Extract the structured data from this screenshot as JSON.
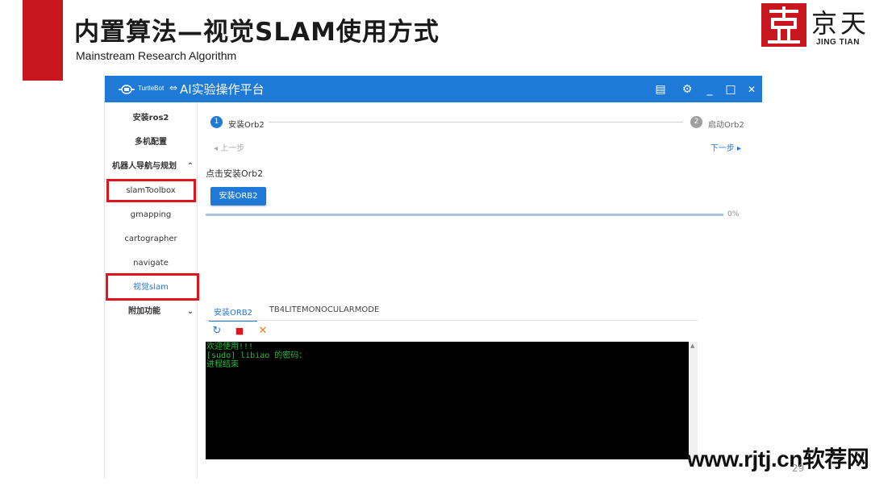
{
  "slide": {
    "title": "内置算法—视觉SLAM使用方式",
    "subtitle": "Mainstream Research Algorithm",
    "page_number": "29",
    "accent_color": "#c8171f"
  },
  "logo": {
    "cn_text": "京天",
    "en_text": "JING TIAN"
  },
  "app": {
    "logo_text": "TurtleBot",
    "logo_symbol": "⇔",
    "title": "AI实验操作平台",
    "controls": {
      "list_icon": "▤",
      "settings_icon": "⚙",
      "minimize": "_",
      "maximize": "□",
      "close": "✕"
    },
    "sidebar": {
      "items": [
        {
          "label": "安装ros2"
        },
        {
          "label": "多机配置"
        },
        {
          "label": "机器人导航与规划",
          "chevron": "⌃"
        },
        {
          "label": "slamToolbox"
        },
        {
          "label": "gmapping"
        },
        {
          "label": "cartographer"
        },
        {
          "label": "navigate"
        },
        {
          "label": "视觉slam"
        },
        {
          "label": "附加功能",
          "chevron": "⌄"
        }
      ]
    },
    "stepper": {
      "steps": [
        {
          "number": "1",
          "label": "安装Orb2",
          "active": true
        },
        {
          "number": "2",
          "label": "启动Orb2",
          "active": false
        }
      ],
      "prev_label": "上一步",
      "next_label": "下一步"
    },
    "hint": "点击安装Orb2",
    "install_button": "安装ORB2",
    "progress": {
      "value": 0,
      "label": "0%"
    },
    "tabs": [
      {
        "label": "安装ORB2",
        "active": true
      },
      {
        "label": "TB4LITEMONOCULARMODE",
        "active": false
      }
    ],
    "toolbar": {
      "refresh_icon": "↻",
      "stop_icon": "■",
      "clear_icon": "✕"
    },
    "terminal": {
      "lines": [
        "欢迎使用!!!",
        "[sudo] libiao 的密码：",
        "进程结束"
      ]
    }
  },
  "watermark": "www.rjtj.cn软荐网"
}
